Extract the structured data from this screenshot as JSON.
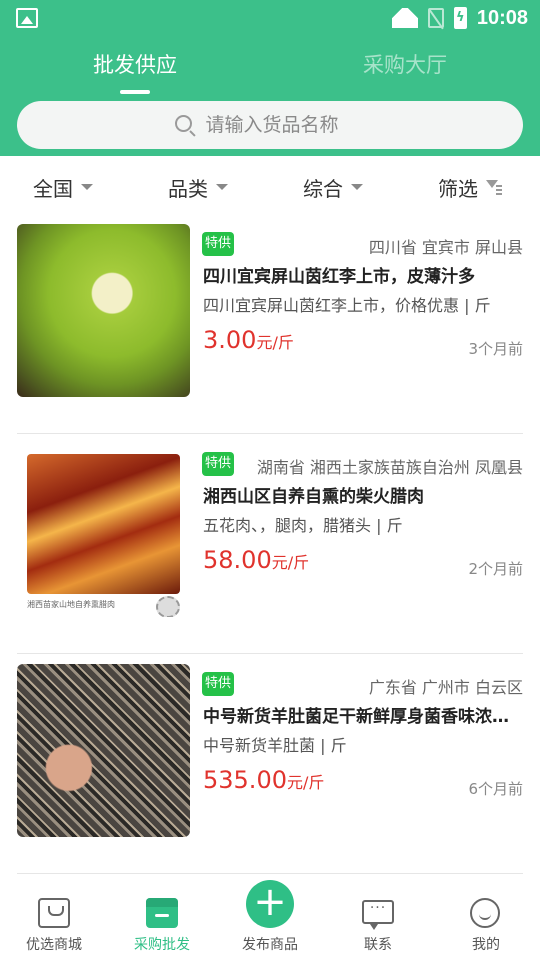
{
  "status_bar": {
    "time": "10:08"
  },
  "tabs": [
    {
      "label": "批发供应",
      "active": true
    },
    {
      "label": "采购大厅",
      "active": false
    }
  ],
  "search": {
    "placeholder": "请输入货品名称"
  },
  "filters": [
    {
      "label": "全国"
    },
    {
      "label": "品类"
    },
    {
      "label": "综合"
    },
    {
      "label": "筛选"
    }
  ],
  "listings": [
    {
      "tag": "特供",
      "location": "四川省 宜宾市 屏山县",
      "title": "四川宜宾屏山茵红李上市，皮薄汁多",
      "desc": "四川宜宾屏山茵红李上市，价格优惠 | 斤",
      "price": "3.00",
      "unit": "元/斤",
      "time": "3个月前"
    },
    {
      "tag": "特供",
      "location": "湖南省 湘西土家族苗族自治州 凤凰县",
      "title": "湘西山区自养自熏的柴火腊肉",
      "desc": "五花肉、，腿肉，腊猪头 | 斤",
      "price": "58.00",
      "unit": "元/斤",
      "time": "2个月前",
      "image_caption": "湘西苗家山地自养熏腊肉"
    },
    {
      "tag": "特供",
      "location": "广东省 广州市 白云区",
      "title": "中号新货羊肚菌足干新鲜厚身菌香味浓一…",
      "desc": "中号新货羊肚菌 | 斤",
      "price": "535.00",
      "unit": "元/斤",
      "time": "6个月前"
    }
  ],
  "bottom_nav": [
    {
      "label": "优选商城",
      "icon": "shopping-bag-icon",
      "active": false
    },
    {
      "label": "采购批发",
      "icon": "store-icon",
      "active": true
    },
    {
      "label": "发布商品",
      "icon": "plus-icon",
      "active": false
    },
    {
      "label": "联系",
      "icon": "chat-icon",
      "active": false
    },
    {
      "label": "我的",
      "icon": "smile-icon",
      "active": false
    }
  ],
  "colors": {
    "brand": "#3cc08a",
    "price": "#e0332d",
    "tag": "#25c148"
  }
}
